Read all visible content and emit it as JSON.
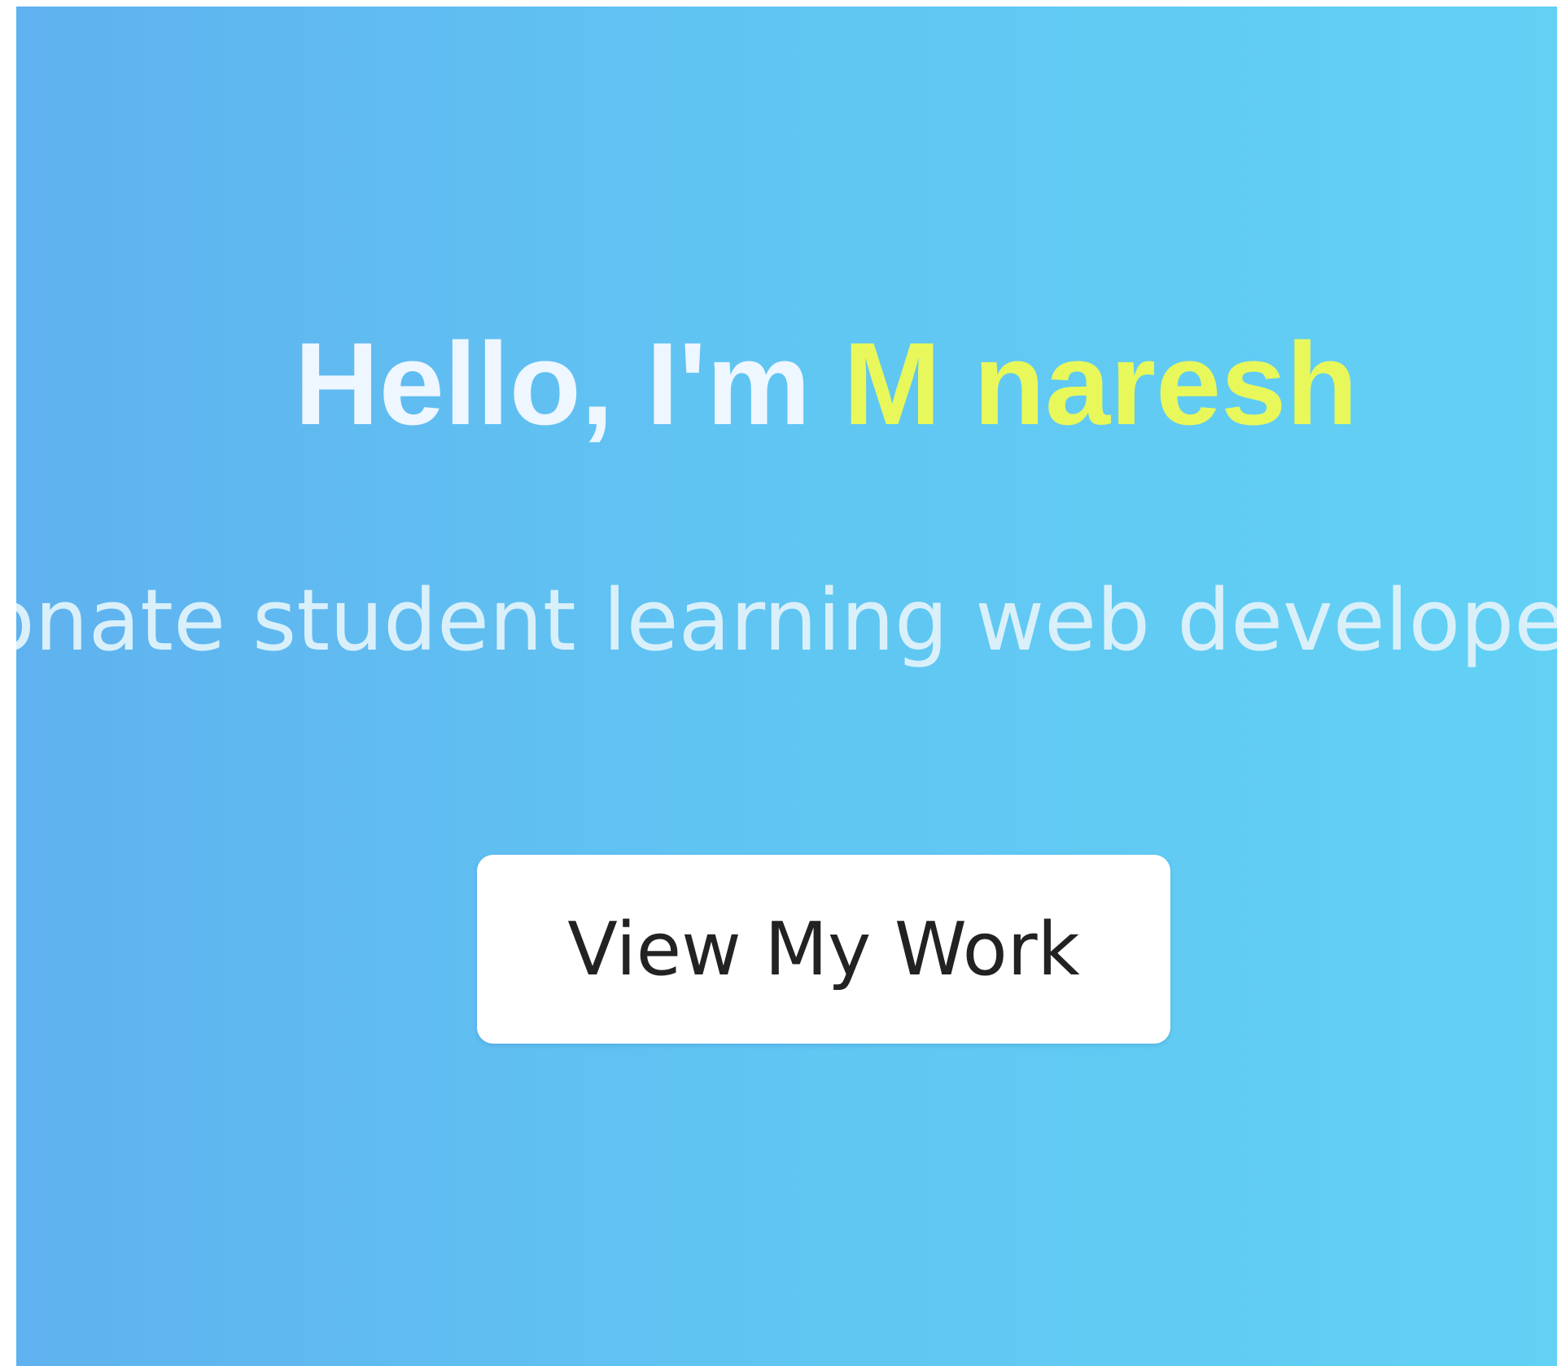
{
  "hero": {
    "greeting": "Hello, I'm",
    "name": "M naresh",
    "tagline": "Passionate student learning web developer",
    "cta_label": "View My Work"
  },
  "colors": {
    "background_start": "#5fb2ef",
    "background_end": "#62d1f4",
    "headline_text": "#eef6ff",
    "name_highlight": "#e8f85a",
    "button_background": "#ffffff",
    "button_text": "#222222"
  }
}
